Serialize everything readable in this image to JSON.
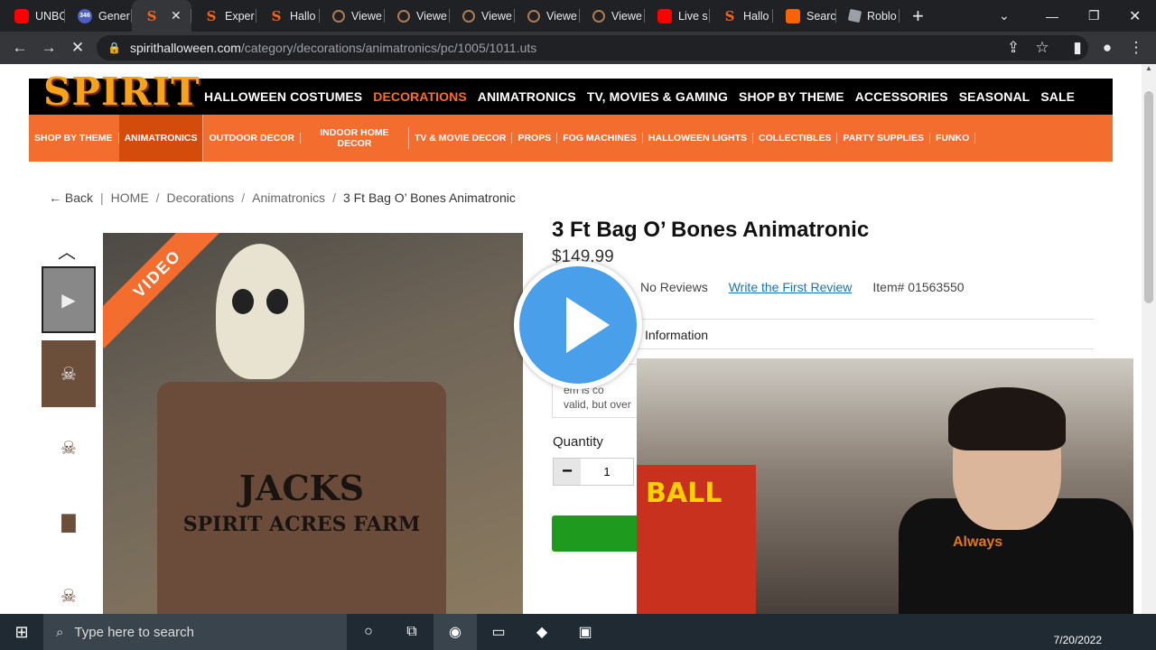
{
  "browser": {
    "tabs": [
      {
        "icon": "youtube-icon",
        "label": "UNBO",
        "kind": "yt"
      },
      {
        "icon": "generic-icon",
        "label": "Gener",
        "badge": "346",
        "kind": "gn"
      },
      {
        "icon": "spirit-icon",
        "label": "",
        "kind": "sp",
        "active": true
      },
      {
        "icon": "spirit-icon",
        "label": "Exper",
        "kind": "sp"
      },
      {
        "icon": "spirit-icon",
        "label": "Hallo",
        "kind": "sp"
      },
      {
        "icon": "viewer-icon",
        "label": "Viewe",
        "kind": "vw"
      },
      {
        "icon": "viewer-icon",
        "label": "Viewe",
        "kind": "vw"
      },
      {
        "icon": "viewer-icon",
        "label": "Viewe",
        "kind": "vw"
      },
      {
        "icon": "viewer-icon",
        "label": "Viewe",
        "kind": "vw"
      },
      {
        "icon": "viewer-icon",
        "label": "Viewe",
        "kind": "vw"
      },
      {
        "icon": "youtube-icon",
        "label": "Live s",
        "kind": "yt"
      },
      {
        "icon": "spirit-icon",
        "label": "Hallo",
        "kind": "sp"
      },
      {
        "icon": "homedepot-icon",
        "label": "Searc",
        "kind": "hd"
      },
      {
        "icon": "roblox-icon",
        "label": "Roblo",
        "kind": "rb"
      }
    ],
    "url_host": "spirithalloween.com",
    "url_path": "/category/decorations/animatronics/pc/1005/1011.uts"
  },
  "site": {
    "logo": "SPIRIT",
    "main_nav": [
      {
        "label": "HALLOWEEN COSTUMES"
      },
      {
        "label": "DECORATIONS",
        "active": true
      },
      {
        "label": "ANIMATRONICS"
      },
      {
        "label": "TV, MOVIES & GAMING"
      },
      {
        "label": "SHOP BY THEME"
      },
      {
        "label": "ACCESSORIES"
      },
      {
        "label": "SEASONAL"
      },
      {
        "label": "SALE"
      }
    ],
    "sub_nav": [
      {
        "label": "SHOP BY THEME"
      },
      {
        "label": "ANIMATRONICS",
        "active": true
      },
      {
        "label": "OUTDOOR DECOR"
      },
      {
        "label": "INDOOR HOME DECOR"
      },
      {
        "label": "TV & MOVIE DECOR"
      },
      {
        "label": "PROPS"
      },
      {
        "label": "FOG MACHINES"
      },
      {
        "label": "HALLOWEEN LIGHTS"
      },
      {
        "label": "COLLECTIBLES"
      },
      {
        "label": "PARTY SUPPLIES"
      },
      {
        "label": "FUNKO"
      }
    ]
  },
  "breadcrumb": {
    "back": "Back",
    "items": [
      "HOME",
      "Decorations",
      "Animatronics"
    ],
    "current": "3 Ft Bag O’ Bones Animatronic"
  },
  "product": {
    "title": "3 Ft Bag O’ Bones Animatronic",
    "price": "$149.99",
    "reviews": "No Reviews",
    "write_review": "Write the First Review",
    "item_number": "Item# 01563550",
    "info_tab": "Information",
    "notice_line1": "em is co",
    "notice_line2": "valid, but over",
    "quantity_label": "Quantity",
    "quantity_value": "1",
    "video_banner": "VIDEO",
    "sack_line1": "JACKS",
    "sack_line2": "SPIRIT ACRES FARM"
  },
  "webcam": {
    "box_text": "BALL",
    "shirt_text": "Always"
  },
  "taskbar": {
    "search_placeholder": "Type here to search",
    "date": "7/20/2022"
  }
}
